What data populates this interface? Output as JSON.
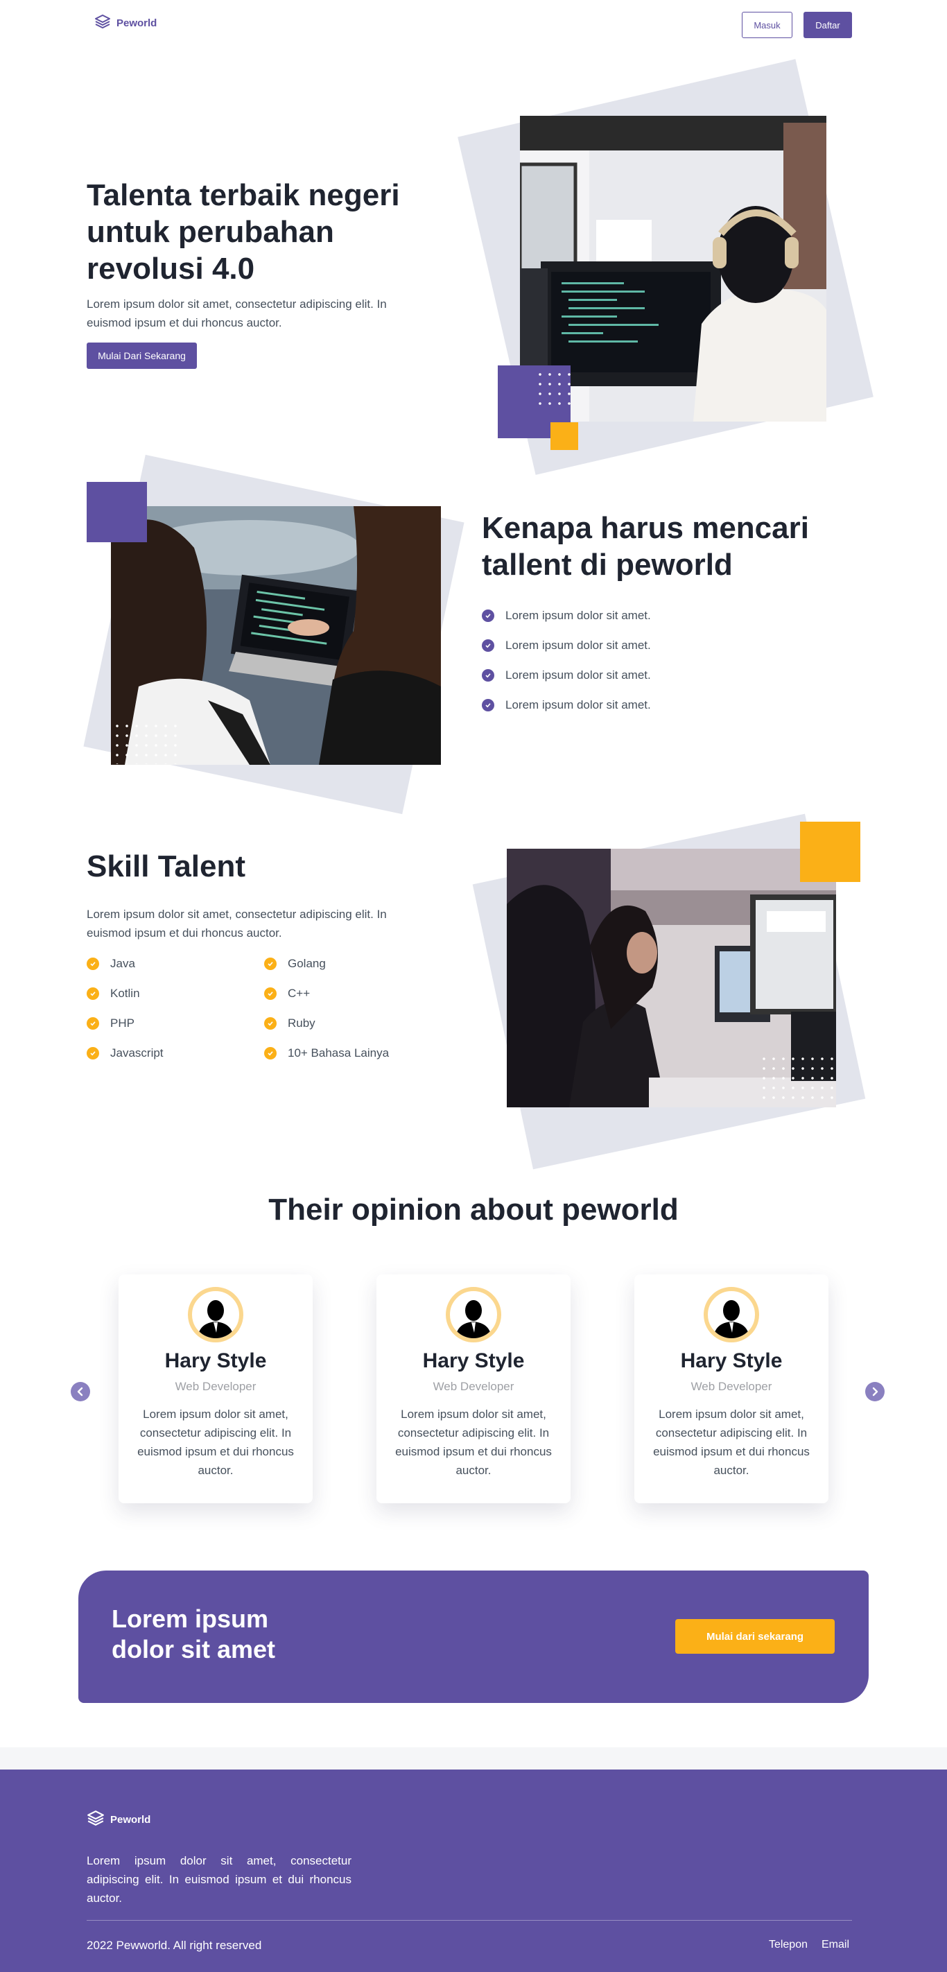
{
  "nav": {
    "brand": "Peworld",
    "login": "Masuk",
    "register": "Daftar"
  },
  "hero": {
    "title": "Talenta terbaik negeri untuk perubahan revolusi 4.0",
    "description": "Lorem ipsum dolor sit amet, consectetur adipiscing elit. In euismod ipsum et dui rhoncus auctor.",
    "cta": "Mulai Dari Sekarang"
  },
  "why": {
    "title": "Kenapa harus mencari tallent di peworld",
    "items": [
      "Lorem ipsum dolor sit amet.",
      "Lorem ipsum dolor sit amet.",
      "Lorem ipsum dolor sit amet.",
      "Lorem ipsum dolor sit amet."
    ]
  },
  "skill": {
    "title": "Skill Talent",
    "description": "Lorem ipsum dolor sit amet, consectetur adipiscing elit. In euismod ipsum et dui rhoncus auctor.",
    "left": [
      "Java",
      "Kotlin",
      "PHP",
      "Javascript"
    ],
    "right": [
      "Golang",
      "C++",
      "Ruby",
      "10+ Bahasa Lainya"
    ]
  },
  "opinion": {
    "title": "Their opinion about peworld",
    "cards": [
      {
        "name": "Hary Style",
        "role": "Web Developer",
        "text": "Lorem ipsum dolor sit amet, consectetur adipiscing elit. In euismod ipsum et dui rhoncus auctor."
      },
      {
        "name": "Hary Style",
        "role": "Web Developer",
        "text": "Lorem ipsum dolor sit amet, consectetur adipiscing elit. In euismod ipsum et dui rhoncus auctor."
      },
      {
        "name": "Hary Style",
        "role": "Web Developer",
        "text": "Lorem ipsum dolor sit amet, consectetur adipiscing elit. In euismod ipsum et dui rhoncus auctor."
      }
    ]
  },
  "banner": {
    "title": "Lorem ipsum dolor sit amet",
    "button": "Mulai dari sekarang"
  },
  "footer": {
    "brand": "Peworld",
    "description": "Lorem ipsum dolor sit amet, consectetur adipiscing elit. In euismod ipsum et dui rhoncus auctor.",
    "copyright": "2022 Pewworld. All right reserved",
    "links": [
      "Telepon",
      "Email"
    ]
  },
  "colors": {
    "primary": "#5e50a1",
    "accent": "#fbb017",
    "text": "#1f2430",
    "muted": "#46505c"
  },
  "icons": {
    "logo": "layers-icon",
    "check": "check-circle-icon",
    "prev": "chevron-left-icon",
    "next": "chevron-right-icon",
    "avatar": "user-silhouette-icon"
  }
}
